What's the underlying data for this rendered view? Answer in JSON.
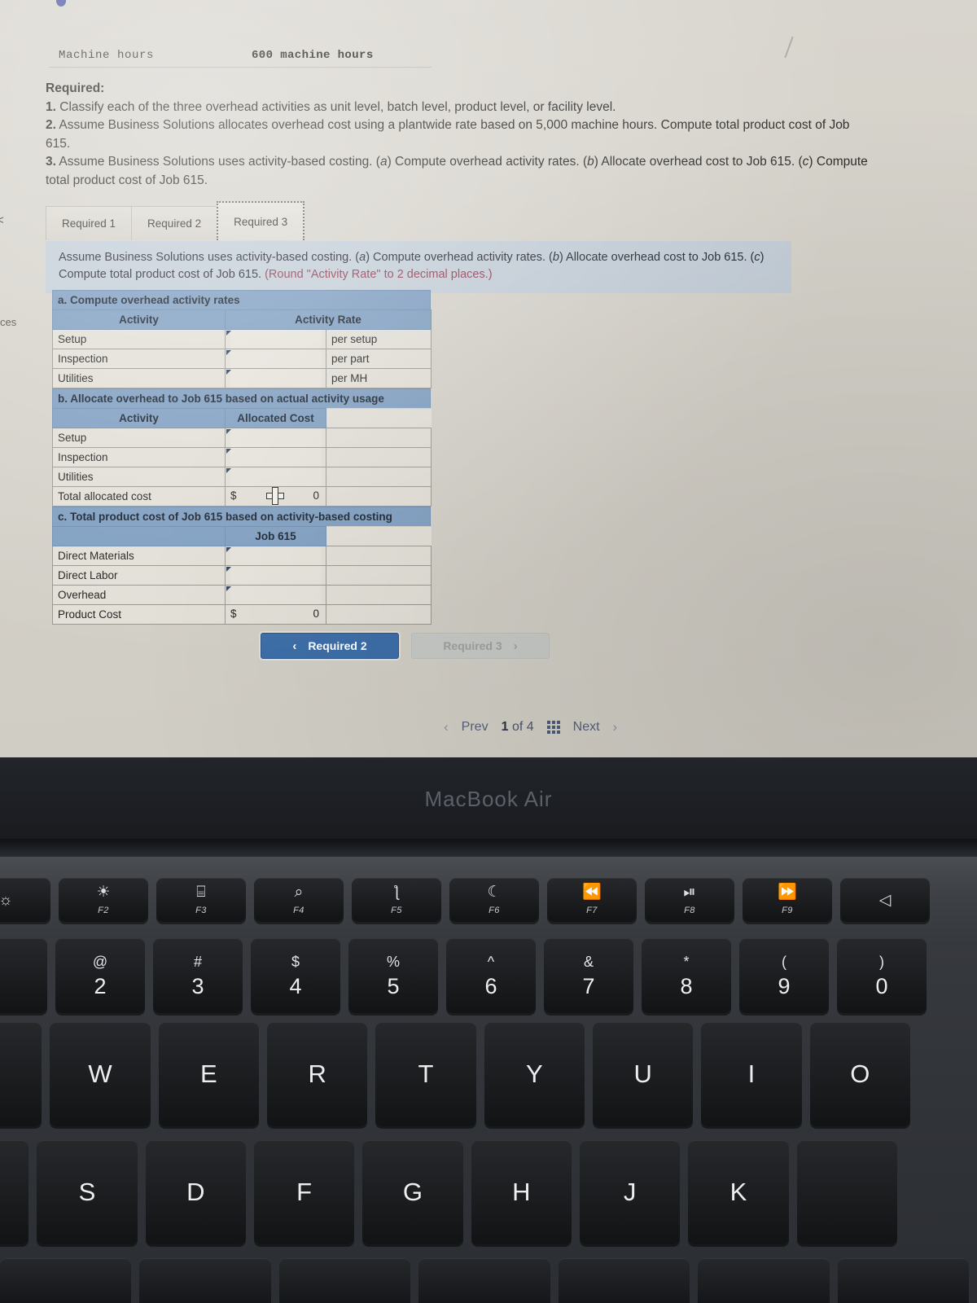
{
  "screen": {
    "edge_fragments": [
      "<",
      "ces"
    ],
    "machine_hours": {
      "label": "Machine hours",
      "value": "600 machine hours"
    },
    "required": {
      "heading": "Required:",
      "item1_num": "1.",
      "item1": " Classify each of the three overhead activities as unit level, batch level, product level, or facility level.",
      "item2_num": "2.",
      "item2": " Assume Business Solutions allocates overhead cost using a plantwide rate based on 5,000 machine hours. Compute total product cost of Job 615.",
      "item3_num": "3.",
      "item3_a": " Assume Business Solutions uses activity-based costing. (",
      "item3_ai": "a",
      "item3_b": ") Compute overhead activity rates. (",
      "item3_bi": "b",
      "item3_c": ") Allocate overhead cost to Job 615. (",
      "item3_ci": "c",
      "item3_d": ") Compute total product cost of Job 615."
    },
    "tabs": [
      {
        "label": "Required 1",
        "active": false
      },
      {
        "label": "Required 2",
        "active": false
      },
      {
        "label": "Required 3",
        "active": true
      }
    ],
    "instruction": {
      "text_a": "Assume Business Solutions uses activity-based costing. (",
      "ital_a": "a",
      "text_b": ") Compute overhead activity rates. (",
      "ital_b": "b",
      "text_c": ") Allocate overhead cost to Job 615. (",
      "ital_c": "c",
      "text_d": ") Compute total product cost of Job 615. ",
      "round_note": "(Round \"Activity Rate\" to 2 decimal places.)"
    },
    "worksheet": {
      "section_a": {
        "title": "a. Compute overhead activity rates",
        "headers": [
          "Activity",
          "Activity Rate"
        ],
        "rows": [
          {
            "activity": "Setup",
            "rate": "",
            "unit": "per setup"
          },
          {
            "activity": "Inspection",
            "rate": "",
            "unit": "per part"
          },
          {
            "activity": "Utilities",
            "rate": "",
            "unit": "per MH"
          }
        ]
      },
      "section_b": {
        "title": "b. Allocate overhead to Job 615 based on actual activity usage",
        "headers": [
          "Activity",
          "Allocated Cost"
        ],
        "rows": [
          {
            "activity": "Setup",
            "cost": ""
          },
          {
            "activity": "Inspection",
            "cost": ""
          },
          {
            "activity": "Utilities",
            "cost": ""
          }
        ],
        "total_label": "Total allocated cost",
        "total_currency": "$",
        "total_value": "0"
      },
      "section_c": {
        "title": "c. Total product cost of Job 615 based on activity-based costing",
        "headers": [
          "",
          "Job 615"
        ],
        "rows": [
          {
            "item": "Direct Materials",
            "amount": ""
          },
          {
            "item": "Direct Labor",
            "amount": ""
          },
          {
            "item": "Overhead",
            "amount": ""
          }
        ],
        "total_label": "Product Cost",
        "total_currency": "$",
        "total_value": "0"
      }
    },
    "nav_buttons": {
      "prev_chevron": "‹",
      "prev_label": "Required 2",
      "next_label": "Required 3",
      "next_chevron": "›"
    },
    "pager": {
      "prev_chevron": "‹",
      "prev_label": "Prev",
      "current": "1",
      "of": "of",
      "total": "4",
      "next_label": "Next",
      "next_chevron": "›"
    },
    "colors": {
      "table_header_blue": "#7d9dc0",
      "instruction_banner": "#c3cdd7",
      "primary_button": "#3d6ea8",
      "disabled_button": "#c6c9c6",
      "round_note_red": "#8e3a4e",
      "screen_background": "#d5d2ca"
    }
  },
  "laptop": {
    "brand": "MacBook Air",
    "function_keys": [
      {
        "glyph": "☀",
        "label": "F2",
        "name": "brightness-up-icon"
      },
      {
        "glyph": "⌸",
        "label": "F3",
        "name": "mission-control-icon"
      },
      {
        "glyph": "⌕",
        "label": "F4",
        "name": "spotlight-search-icon"
      },
      {
        "glyph": "ƪ",
        "label": "F5",
        "name": "dictation-mic-icon"
      },
      {
        "glyph": "☾",
        "label": "F6",
        "name": "do-not-disturb-moon-icon"
      },
      {
        "glyph": "⏪",
        "label": "F7",
        "name": "rewind-icon"
      },
      {
        "glyph": "⏯",
        "label": "F8",
        "name": "play-pause-icon"
      },
      {
        "glyph": "⏩",
        "label": "F9",
        "name": "fast-forward-icon"
      }
    ],
    "number_keys": [
      {
        "upper": "@",
        "lower": "2"
      },
      {
        "upper": "#",
        "lower": "3"
      },
      {
        "upper": "$",
        "lower": "4"
      },
      {
        "upper": "%",
        "lower": "5"
      },
      {
        "upper": "^",
        "lower": "6"
      },
      {
        "upper": "&",
        "lower": "7"
      },
      {
        "upper": "*",
        "lower": "8"
      },
      {
        "upper": "(",
        "lower": "9"
      },
      {
        "upper": ")",
        "lower": "0"
      }
    ],
    "letter_row_top": [
      "W",
      "E",
      "R",
      "T",
      "Y",
      "U",
      "I",
      "O"
    ],
    "letter_row_home": [
      "S",
      "D",
      "F",
      "G",
      "H",
      "J",
      "K"
    ]
  }
}
